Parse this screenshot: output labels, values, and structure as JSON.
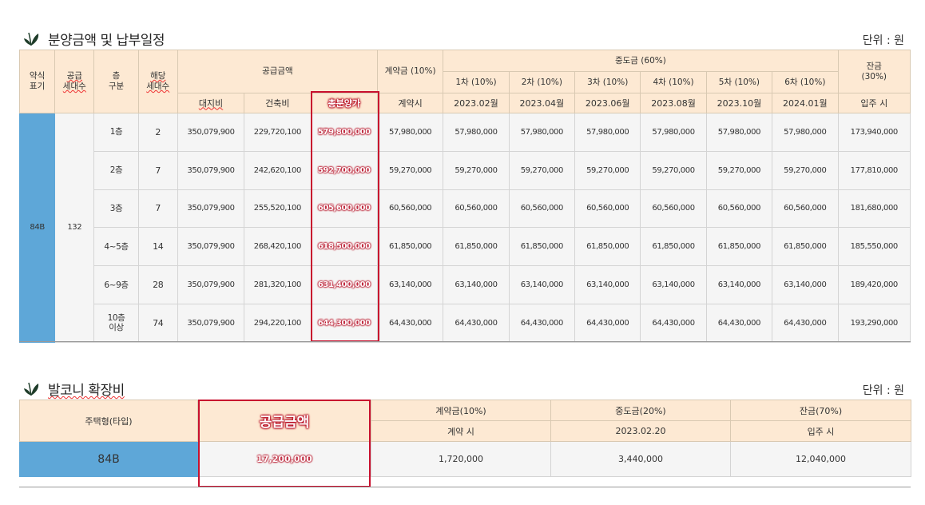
{
  "section1": {
    "title": "분양금액 및 납부일정",
    "unit": "단위 : 원",
    "headers": {
      "type_label": "약식\n표기",
      "households_label": "공급\n세대수",
      "floor_label": "층\n구분",
      "floor_households_label": "해당\n세대수",
      "supply_amount": "공급금액",
      "land": "대지비",
      "building": "건축비",
      "total": "총분양가",
      "contract": "계약금 (10%)",
      "contract_when": "계약시",
      "middle": "중도금 (60%)",
      "middle_items": [
        {
          "label": "1차 (10%)",
          "date": "2023.02월"
        },
        {
          "label": "2차 (10%)",
          "date": "2023.04월"
        },
        {
          "label": "3차 (10%)",
          "date": "2023.06월"
        },
        {
          "label": "4차 (10%)",
          "date": "2023.08월"
        },
        {
          "label": "5차 (10%)",
          "date": "2023.10월"
        },
        {
          "label": "6차 (10%)",
          "date": "2024.01월"
        }
      ],
      "balance": "잔금\n(30%)",
      "balance_when": "입주 시"
    },
    "type": "84B",
    "households": "132",
    "rows": [
      {
        "floor": "1층",
        "count": "2",
        "land": "350,079,900",
        "building": "229,720,100",
        "total": "579,800,000",
        "contract": "57,980,000",
        "middle": "57,980,000",
        "balance": "173,940,000"
      },
      {
        "floor": "2층",
        "count": "7",
        "land": "350,079,900",
        "building": "242,620,100",
        "total": "592,700,000",
        "contract": "59,270,000",
        "middle": "59,270,000",
        "balance": "177,810,000"
      },
      {
        "floor": "3층",
        "count": "7",
        "land": "350,079,900",
        "building": "255,520,100",
        "total": "605,600,000",
        "contract": "60,560,000",
        "middle": "60,560,000",
        "balance": "181,680,000"
      },
      {
        "floor": "4~5층",
        "count": "14",
        "land": "350,079,900",
        "building": "268,420,100",
        "total": "618,500,000",
        "contract": "61,850,000",
        "middle": "61,850,000",
        "balance": "185,550,000"
      },
      {
        "floor": "6~9층",
        "count": "28",
        "land": "350,079,900",
        "building": "281,320,100",
        "total": "631,400,000",
        "contract": "63,140,000",
        "middle": "63,140,000",
        "balance": "189,420,000"
      },
      {
        "floor": "10층\n이상",
        "count": "74",
        "land": "350,079,900",
        "building": "294,220,100",
        "total": "644,300,000",
        "contract": "64,430,000",
        "middle": "64,430,000",
        "balance": "193,290,000"
      }
    ]
  },
  "section2": {
    "title": "발코니 확장비",
    "unit": "단위 : 원",
    "headers": {
      "type": "주택형(타입)",
      "supply": "공급금액",
      "contract": "계약금(10%)",
      "contract_when": "계약 시",
      "middle": "중도금(20%)",
      "middle_when": "2023.02.20",
      "balance": "잔금(70%)",
      "balance_when": "입주 시"
    },
    "row": {
      "type": "84B",
      "supply": "17,200,000",
      "contract": "1,720,000",
      "middle": "3,440,000",
      "balance": "12,040,000"
    }
  },
  "colors": {
    "header_bg": "#fde9d3",
    "type_bg": "#5ea7d8",
    "highlight": "#c8102e"
  },
  "icons": {
    "section_icon": "sprout-icon"
  }
}
